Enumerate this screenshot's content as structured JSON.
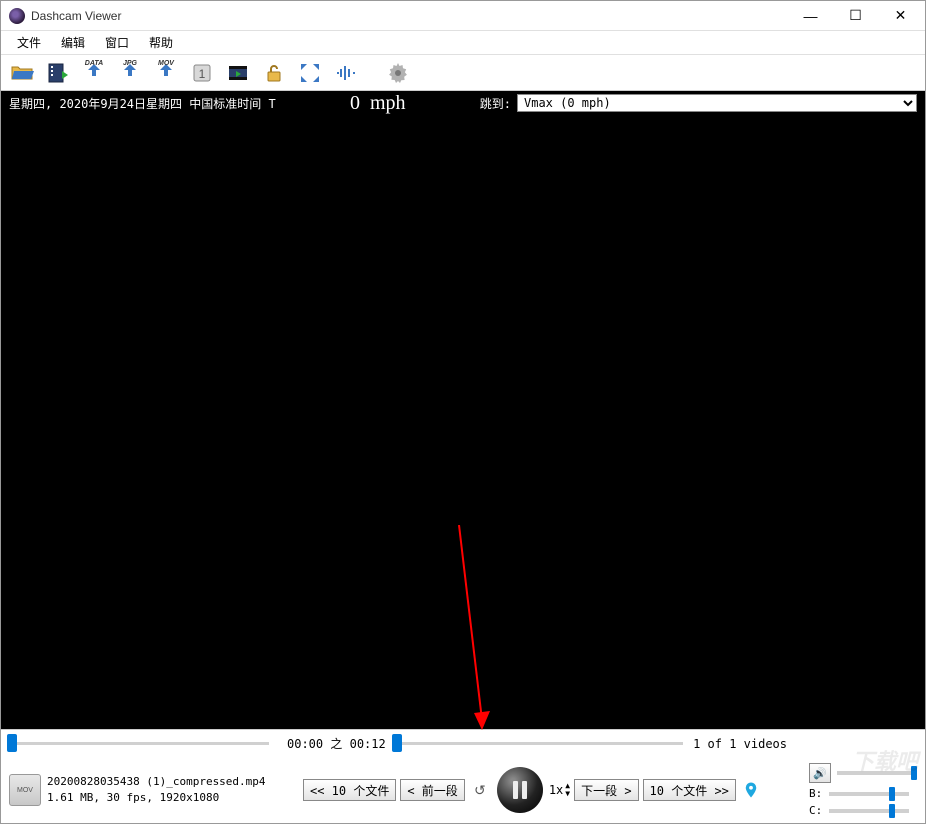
{
  "window": {
    "title": "Dashcam Viewer"
  },
  "menu": {
    "file": "文件",
    "edit": "编辑",
    "window": "窗口",
    "help": "帮助"
  },
  "toolbar_icons": {
    "open": "open",
    "film": "film",
    "data": "DATA",
    "jpg": "JPG",
    "mov": "MOV",
    "one": "1",
    "clip": "clip",
    "lock": "lock",
    "fullscreen": "fullscreen",
    "audio": "audio",
    "settings": "settings"
  },
  "header": {
    "date": "星期四, 2020年9月24日星期四 中国标准时间 T",
    "speed_value": "0",
    "speed_unit": "mph",
    "jump_label": "跳到:",
    "jump_selected": "Vmax (0 mph)"
  },
  "progress": {
    "time_current": "00:00",
    "time_sep": "之",
    "time_total": "00:12",
    "video_count": "1 of 1 videos"
  },
  "file": {
    "name": "20200828035438 (1)_compressed.mp4",
    "meta": "1.61 MB, 30 fps, 1920x1080",
    "icon_label": "MOV"
  },
  "controls": {
    "back10": "<< 10 个文件",
    "prev": "< 前一段",
    "speed": "1x",
    "next": "下一段 >",
    "fwd10": "10 个文件 >>"
  },
  "panel": {
    "b_label": "B:",
    "c_label": "C:"
  }
}
